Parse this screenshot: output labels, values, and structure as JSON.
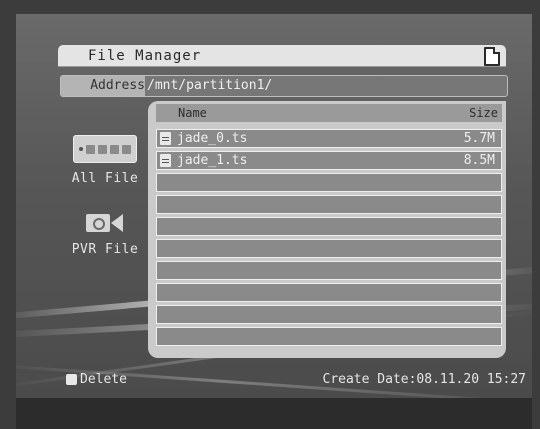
{
  "window": {
    "title": "File Manager",
    "title_icon": "document-icon"
  },
  "address": {
    "label": "Address",
    "path": "/mnt/partition1/"
  },
  "sidebar": {
    "items": [
      {
        "label": "All File",
        "icon": "all-file-icon"
      },
      {
        "label": "PVR File",
        "icon": "video-camera-icon"
      }
    ]
  },
  "list": {
    "columns": {
      "name": "Name",
      "size": "Size"
    },
    "files": [
      {
        "name": "jade_0.ts",
        "size": "5.7M"
      },
      {
        "name": "jade_1.ts",
        "size": "8.5M"
      }
    ]
  },
  "footer": {
    "delete_label": "Delete",
    "delete_icon": "delete-key-icon",
    "date_label": "Create Date:",
    "date_value": "08.11.20 15:27"
  }
}
